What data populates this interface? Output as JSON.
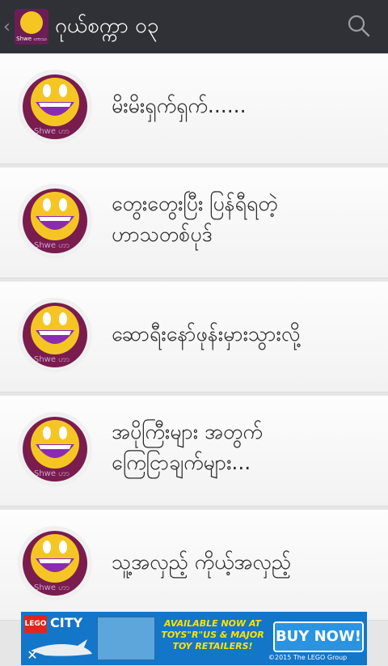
{
  "appbar": {
    "back_icon": "chevron-left-icon",
    "logo_caption": "Shwe ဟာသ",
    "title": "ဂုယ်စက္ကာ ၀၃",
    "search_icon": "search-icon"
  },
  "list": {
    "items": [
      {
        "lines": [
          "မိးမိးရှက်ရှက်......"
        ],
        "watermark": "Shwe ဟာ"
      },
      {
        "lines": [
          "တွေးတွေးပြီး ပြန်ရီရတဲ့",
          "ဟာသတစ်ပုဒ်"
        ],
        "watermark": "Shwe ဟာ"
      },
      {
        "lines": [
          "ဆောရီးနော်ဖုန်းမှားသွားလို့"
        ],
        "watermark": "Shwe ဟာ"
      },
      {
        "lines": [
          "အပိုကြီးများ အတွက်",
          "ကြေငြာချက်များ..."
        ],
        "watermark": "Shwe ဟာ"
      },
      {
        "lines": [
          "သူ့အလှည့် ကိုယ့်အလှည့်"
        ],
        "watermark": "Shwe ဟာ"
      }
    ]
  },
  "ad": {
    "brand": "LEGO",
    "line": "CITY",
    "promo": "AVAILABLE NOW AT TOYS\"R\"US & MAJOR TOY RETAILERS!",
    "cta": "BUY NOW!",
    "copyright": "©2015 The LEGO Group",
    "close_icon": "close-icon"
  },
  "colors": {
    "appbar": "#2f3137",
    "avatar_bg": "#7a1c4e",
    "face": "#f5c623",
    "ad_bg": "#1476c8"
  }
}
